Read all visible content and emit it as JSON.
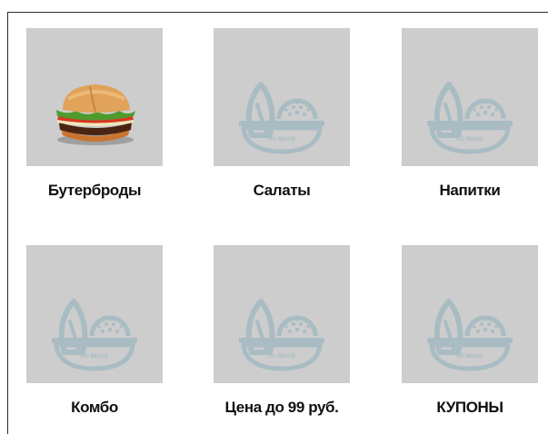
{
  "categories": [
    {
      "label": "Бутерброды",
      "image": "burger-photo"
    },
    {
      "label": "Салаты",
      "image": "no-image-placeholder",
      "placeholder_text": "NO IMAGE"
    },
    {
      "label": "Напитки",
      "image": "no-image-placeholder",
      "placeholder_text": "NO IMAGE"
    },
    {
      "label": "Комбо",
      "image": "no-image-placeholder",
      "placeholder_text": "NO IMAGE"
    },
    {
      "label": "Цена до 99 руб.",
      "image": "no-image-placeholder",
      "placeholder_text": "NO IMAGE"
    },
    {
      "label": "КУПОНЫ",
      "image": "no-image-placeholder",
      "placeholder_text": "NO IMAGE"
    }
  ],
  "colors": {
    "placeholder_bg": "#cdcdcd",
    "placeholder_icon": "#a9bcc3",
    "label_text": "#111111"
  }
}
